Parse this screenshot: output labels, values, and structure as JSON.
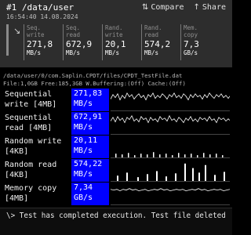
{
  "header": {
    "title": "#1 /data/user",
    "timestamp": "16:54:40 14.08.2024",
    "compare_label": "Compare",
    "share_label": "Share",
    "compare_icon": "compare-icon",
    "share_icon": "share-icon",
    "summary_icon": "sequential-arrow-icon"
  },
  "summary": [
    {
      "label_line1": "Seq.",
      "label_line2": "write",
      "value": "271,8",
      "unit": "MB/s"
    },
    {
      "label_line1": "Seq.",
      "label_line2": "read",
      "value": "672,9",
      "unit": "MB/s"
    },
    {
      "label_line1": "Rand.",
      "label_line2": "write",
      "value": "20,1",
      "unit": "MB/s"
    },
    {
      "label_line1": "Rand.",
      "label_line2": "read",
      "value": "574,2",
      "unit": "MB/s"
    },
    {
      "label_line1": "Mem.",
      "label_line2": "copy",
      "value": "7,3",
      "unit": "GB/s"
    }
  ],
  "info": {
    "path": "/data/user/0/com.Saplin.CPDT/files/CPDT_TestFile.dat",
    "details": "File:1,0GB Free:185,3GB W.Buffering:(Off) Cache:(Off)"
  },
  "tests": [
    {
      "name_line1": "Sequential",
      "name_line2": "write [4MB]",
      "value": "271,83",
      "unit": "MB/s"
    },
    {
      "name_line1": "Sequential",
      "name_line2": "read [4MB]",
      "value": "672,91",
      "unit": "MB/s"
    },
    {
      "name_line1": "Random write",
      "name_line2": "[4KB]",
      "value": "20,11",
      "unit": "MB/s"
    },
    {
      "name_line1": "Random read",
      "name_line2": "[4KB]",
      "value": "574,22",
      "unit": "MB/s"
    },
    {
      "name_line1": "Memory copy",
      "name_line2": "[4MB]",
      "value": "7,34",
      "unit": "GB/s"
    }
  ],
  "console": {
    "message": "\\> Test has completed execution. Test file deleted"
  },
  "colors": {
    "result_highlight": "#0000ff",
    "header_bg": "#2d2d2d",
    "background": "#000000"
  }
}
